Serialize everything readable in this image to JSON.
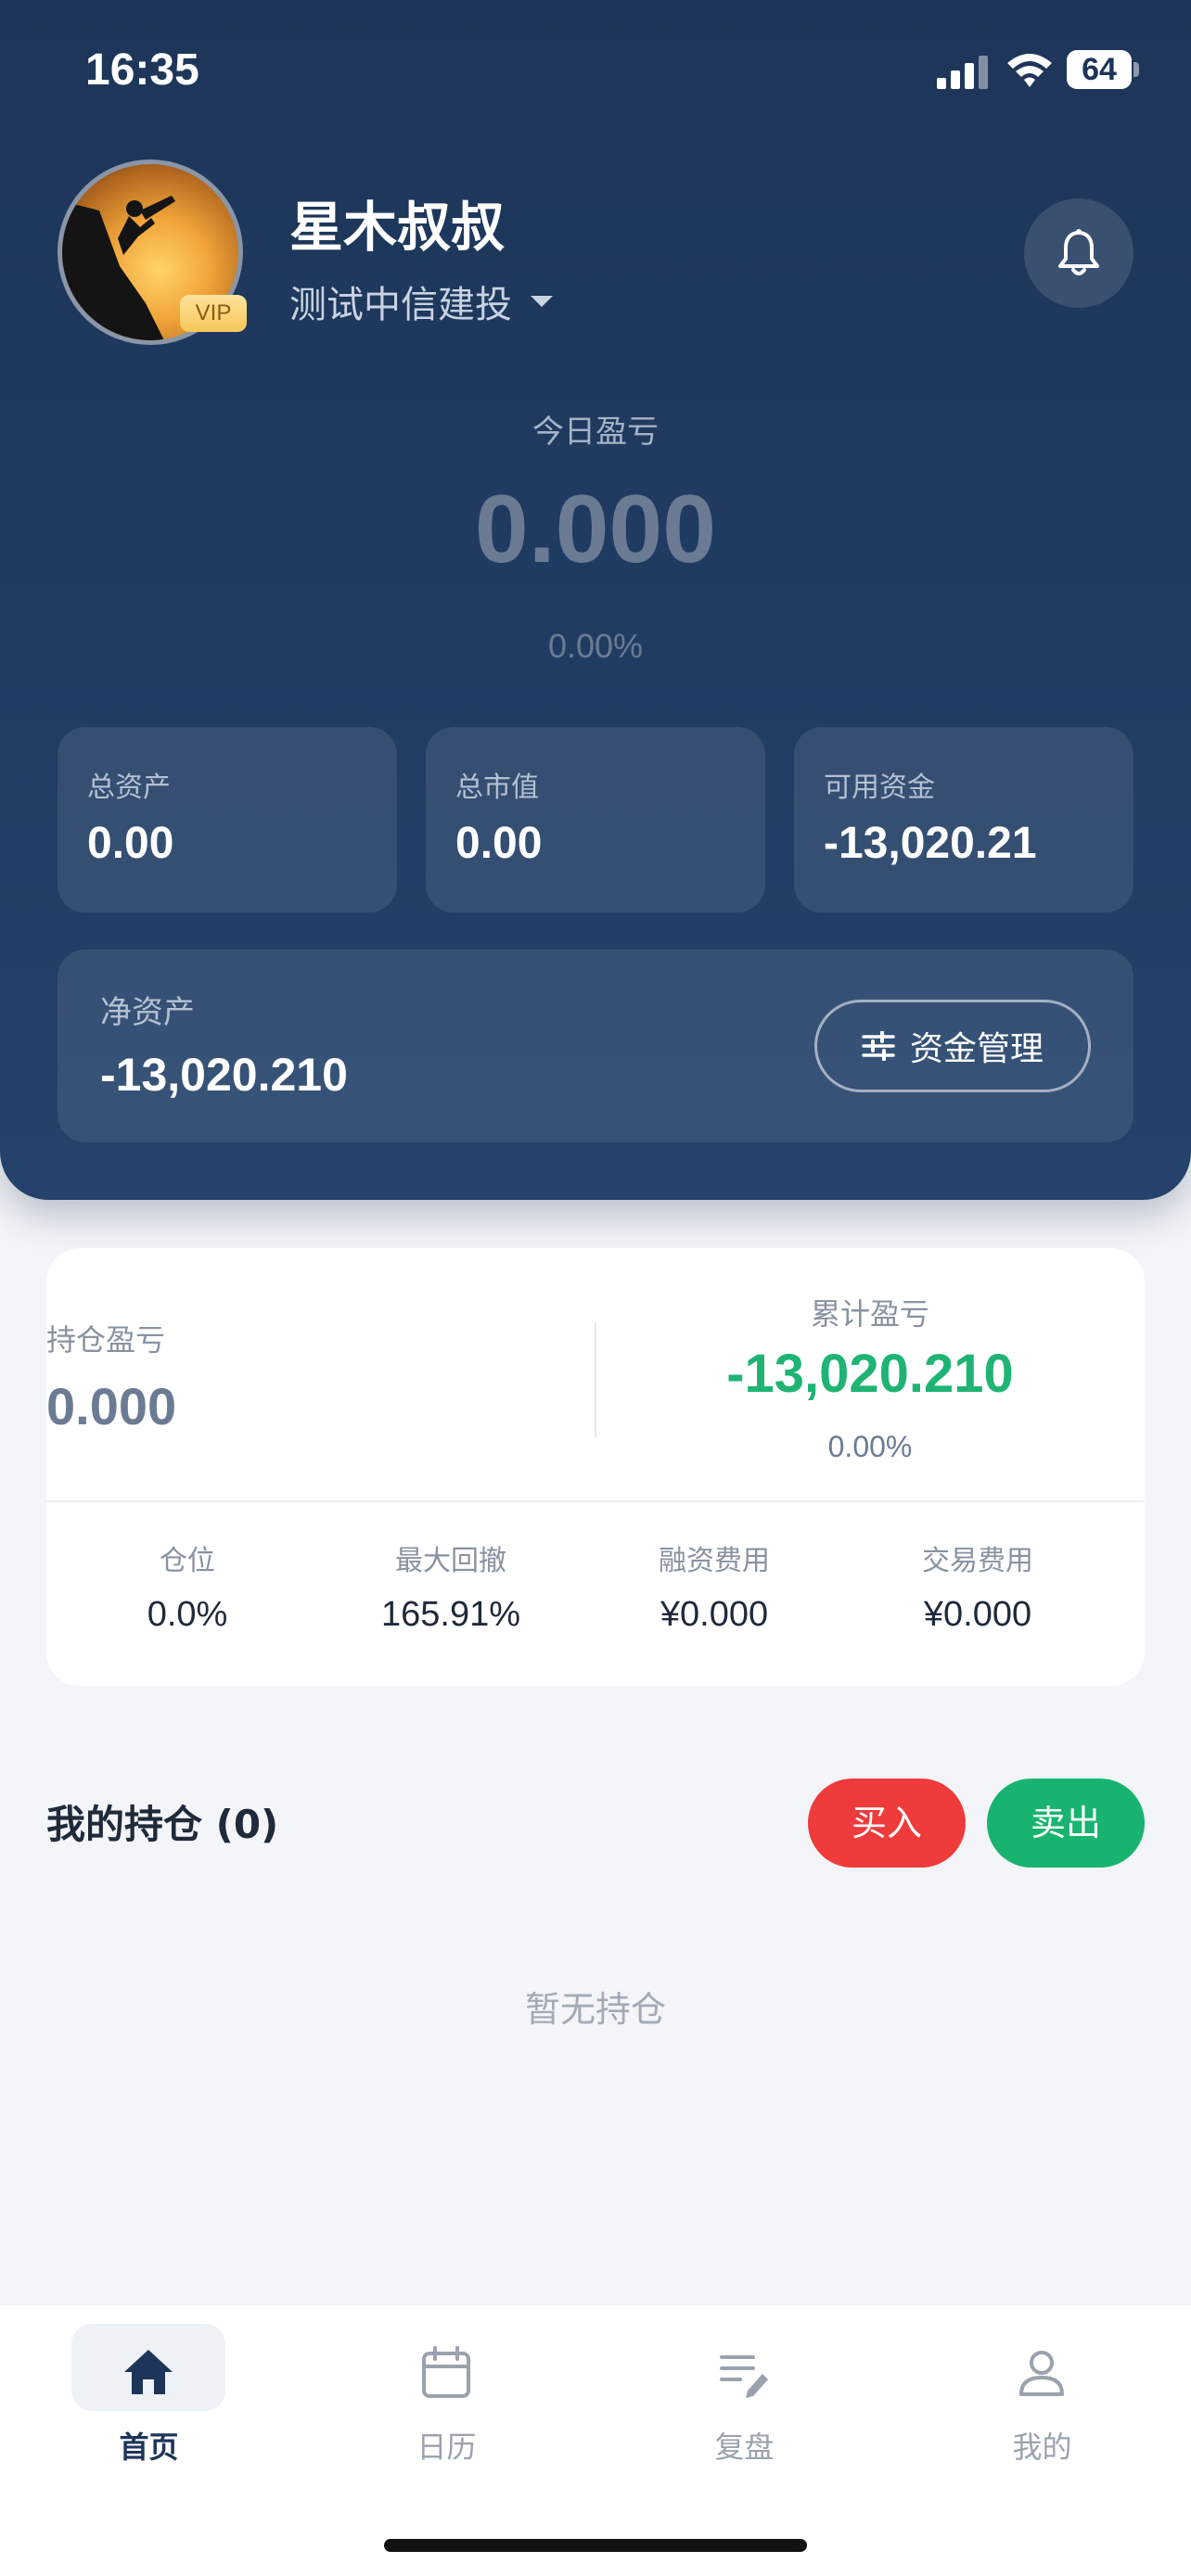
{
  "status_bar": {
    "time": "16:35",
    "battery": "64",
    "icons": [
      "signal-icon",
      "wifi-icon",
      "battery-icon"
    ]
  },
  "profile": {
    "name": "星木叔叔",
    "badge": "VIP",
    "account": "测试中信建投"
  },
  "today": {
    "label": "今日盈亏",
    "value": "0.000",
    "percent": "0.00%"
  },
  "stats": [
    {
      "label": "总资产",
      "value": "0.00"
    },
    {
      "label": "总市值",
      "value": "0.00"
    },
    {
      "label": "可用资金",
      "value": "-13,020.21"
    }
  ],
  "net_assets": {
    "label": "净资产",
    "value": "-13,020.210",
    "button_label": "资金管理"
  },
  "summary": {
    "holding_pnl_label": "持仓盈亏",
    "holding_pnl_value": "0.000",
    "cumulative_pnl_label": "累计盈亏",
    "cumulative_pnl_value": "-13,020.210",
    "cumulative_pnl_percent": "0.00%",
    "metrics": [
      {
        "label": "仓位",
        "value": "0.0%"
      },
      {
        "label": "最大回撤",
        "value": "165.91%"
      },
      {
        "label": "融资费用",
        "value": "¥0.000"
      },
      {
        "label": "交易费用",
        "value": "¥0.000"
      }
    ]
  },
  "holdings": {
    "title": "我的持仓 (0)",
    "buy_label": "买入",
    "sell_label": "卖出",
    "empty_text": "暂无持仓"
  },
  "tabs": [
    {
      "label": "首页",
      "icon": "home-icon",
      "active": true
    },
    {
      "label": "日历",
      "icon": "calendar-icon",
      "active": false
    },
    {
      "label": "复盘",
      "icon": "review-icon",
      "active": false
    },
    {
      "label": "我的",
      "icon": "user-icon",
      "active": false
    }
  ],
  "colors": {
    "header_bg": "#1d3558",
    "accent_green": "#1fb474",
    "buy_red": "#ef3b3b",
    "sell_green": "#18b36f"
  }
}
